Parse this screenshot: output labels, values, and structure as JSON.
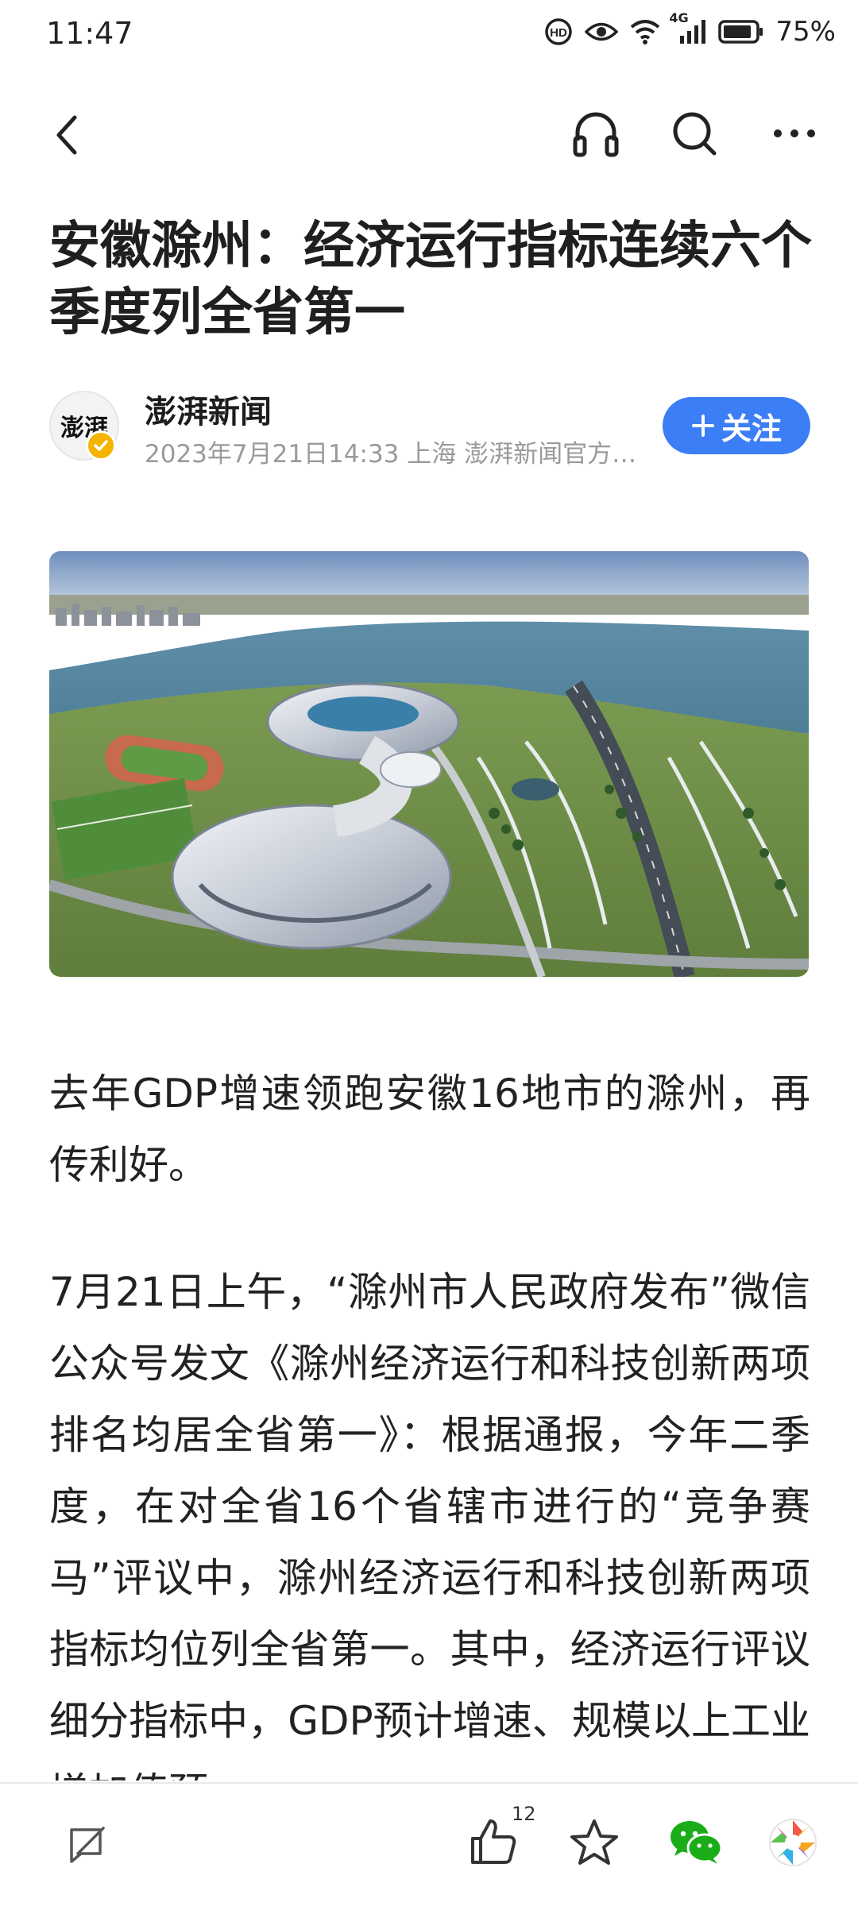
{
  "status_bar": {
    "time": "11:47",
    "network": "4G",
    "battery": "75%",
    "icons": [
      "hd-call-icon",
      "eye-icon",
      "wifi-icon",
      "signal-icon",
      "battery-icon"
    ]
  },
  "nav": {
    "icons": [
      "back-icon",
      "headphones-icon",
      "search-icon",
      "more-icon"
    ]
  },
  "article": {
    "title": "安徽滁州：经济运行指标连续六个季度列全省第一",
    "author": {
      "avatar_text": "澎湃",
      "name": "澎湃新闻",
      "meta": "2023年7月21日14:33 上海 澎湃新闻官方…",
      "follow_label": "关注"
    },
    "paragraphs": [
      "去年GDP增速领跑安徽16地市的滁州，再传利好。",
      "7月21日上午，“滁州市人民政府发布”微信公众号发文《滁州经济运行和科技创新两项排名均居全省第一》：根据通报，今年二季度，在对全省16个省辖市进行的“竞争赛马”评议中，滁州经济运行和科技创新两项指标均位列全省第一。其中，经济运行评议细分指标中，GDP预计增速、规模以上工业增加值预"
    ]
  },
  "bottom_bar": {
    "like_count": "12",
    "icons": [
      "comment-icon",
      "like-icon",
      "star-icon",
      "wechat-icon",
      "moments-icon"
    ]
  },
  "colors": {
    "accent": "#3b7ef6",
    "verified": "#f5b400",
    "wechat": "#1aad19"
  }
}
